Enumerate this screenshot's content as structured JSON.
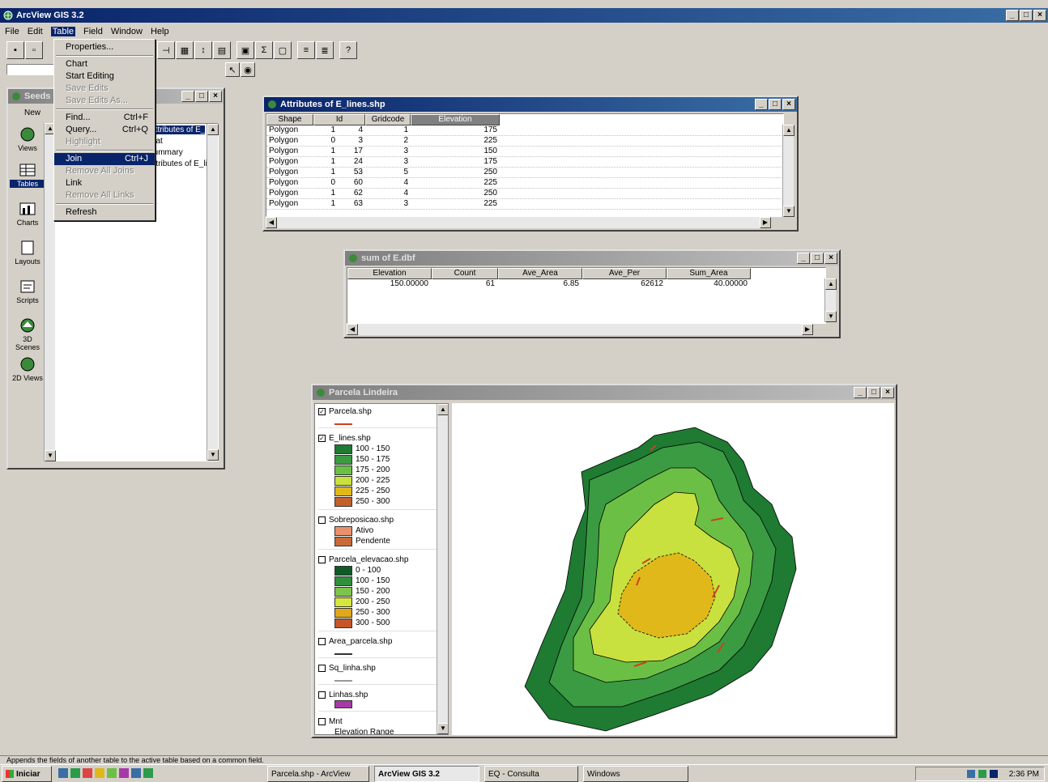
{
  "app": {
    "title": "ArcView GIS 3.2",
    "menus": [
      "File",
      "Edit",
      "Table",
      "Field",
      "Window",
      "Help"
    ],
    "status_text": "Appends the fields of another table to the active table based on a common field."
  },
  "table_menu": {
    "items": [
      {
        "label": "Properties...",
        "shortcut": "",
        "disabled": false
      },
      {
        "sep": true
      },
      {
        "label": "Chart",
        "shortcut": "",
        "disabled": false
      },
      {
        "label": "Start Editing",
        "shortcut": "",
        "disabled": false
      },
      {
        "label": "Save Edits",
        "shortcut": "",
        "disabled": true
      },
      {
        "label": "Save Edits As...",
        "shortcut": "",
        "disabled": true
      },
      {
        "sep": true
      },
      {
        "label": "Find...",
        "shortcut": "Ctrl+F",
        "disabled": false
      },
      {
        "label": "Query...",
        "shortcut": "Ctrl+Q",
        "disabled": false
      },
      {
        "label": "Highlight",
        "shortcut": "",
        "disabled": true
      },
      {
        "sep": true
      },
      {
        "label": "Join",
        "shortcut": "Ctrl+J",
        "disabled": false,
        "highlighted": true
      },
      {
        "label": "Remove All Joins",
        "shortcut": "",
        "disabled": true
      },
      {
        "label": "Link",
        "shortcut": "",
        "disabled": false
      },
      {
        "label": "Remove All Links",
        "shortcut": "",
        "disabled": true
      },
      {
        "sep": true
      },
      {
        "label": "Refresh",
        "shortcut": "",
        "disabled": false
      }
    ]
  },
  "project_window": {
    "title": "Seeds",
    "new_label": "New",
    "icons": [
      "Views",
      "Tables",
      "Charts",
      "Layouts",
      "Scripts",
      "3D Scenes",
      "2D Views"
    ],
    "list_items": [
      "Attributes of E_lines.shp",
      "Stat",
      "Summary",
      "Attributes of E_lines.shp"
    ]
  },
  "attributes_window": {
    "title": "Attributes of E_lines.shp",
    "columns": [
      "Shape",
      "Id",
      "Gridcode",
      "Elevation"
    ],
    "rows": [
      [
        "Polygon",
        "1",
        "4",
        "1",
        "175"
      ],
      [
        "Polygon",
        "0",
        "3",
        "2",
        "225"
      ],
      [
        "Polygon",
        "1",
        "17",
        "3",
        "150"
      ],
      [
        "Polygon",
        "1",
        "24",
        "3",
        "175"
      ],
      [
        "Polygon",
        "1",
        "53",
        "5",
        "250"
      ],
      [
        "Polygon",
        "0",
        "60",
        "4",
        "225"
      ],
      [
        "Polygon",
        "1",
        "62",
        "4",
        "250"
      ],
      [
        "Polygon",
        "1",
        "63",
        "3",
        "225"
      ]
    ]
  },
  "summary_window": {
    "title": "sum of E.dbf",
    "columns": [
      "Elevation",
      "Count",
      "Ave_Area",
      "Ave_Per",
      "Sum_Area"
    ],
    "row": [
      "150.00000",
      "61",
      "6.85",
      "62612",
      "40.00000"
    ]
  },
  "map_window": {
    "title": "Parcela Lindeira",
    "legend": [
      {
        "name": "Parcela.shp",
        "checked": true,
        "type": "line",
        "color": "#d04020",
        "classes": []
      },
      {
        "name": "E_lines.shp",
        "checked": true,
        "type": "classes",
        "classes": [
          {
            "label": "100 - 150",
            "color": "#1f7a32"
          },
          {
            "label": "150 - 175",
            "color": "#3a9b42"
          },
          {
            "label": "175 - 200",
            "color": "#6cbf45"
          },
          {
            "label": "200 - 225",
            "color": "#c9e13f"
          },
          {
            "label": "225 - 250",
            "color": "#e0b81a"
          },
          {
            "label": "250 - 300",
            "color": "#c1622b"
          }
        ]
      },
      {
        "name": "Sobreposicao.shp",
        "checked": false,
        "type": "classes",
        "classes": [
          {
            "label": "Ativo",
            "color": "#e8916a"
          },
          {
            "label": "Pendente",
            "color": "#c86a3a"
          }
        ]
      },
      {
        "name": "Parcela_elevacao.shp",
        "checked": false,
        "type": "classes",
        "classes": [
          {
            "label": "0 - 100",
            "color": "#0f5a26"
          },
          {
            "label": "100 - 150",
            "color": "#2f8f3c"
          },
          {
            "label": "150 - 200",
            "color": "#7cc44a"
          },
          {
            "label": "200 - 250",
            "color": "#d5e63c"
          },
          {
            "label": "250 - 300",
            "color": "#e0a81c"
          },
          {
            "label": "300 - 500",
            "color": "#c5552a"
          }
        ]
      },
      {
        "name": "Area_parcela.shp",
        "checked": false,
        "type": "line",
        "color": "#333333",
        "classes": []
      },
      {
        "name": "Sq_linha.shp",
        "checked": false,
        "type": "line",
        "color": "#999999",
        "classes": []
      },
      {
        "name": "Linhas.shp",
        "checked": false,
        "type": "fill",
        "color": "#a63aa6",
        "classes": []
      },
      {
        "name": "Mnt",
        "checked": false,
        "type": "text",
        "color": "#000000",
        "classes": [
          {
            "label": "Elevation Range",
            "color": ""
          }
        ]
      }
    ]
  },
  "taskbar": {
    "start_label": "Iniciar",
    "buttons": [
      "Parcela.shp - ArcView",
      "ArcView GIS 3.2",
      "EQ - Consulta",
      "Windows"
    ],
    "clock": "2:36 PM"
  }
}
